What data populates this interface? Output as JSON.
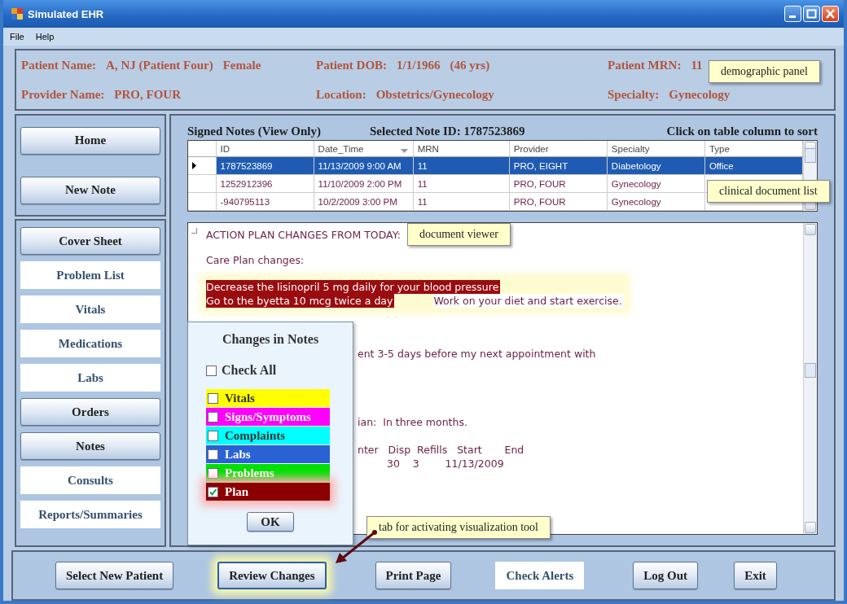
{
  "window": {
    "title": "Simulated EHR"
  },
  "menu": [
    "File",
    "Help"
  ],
  "demographics": [
    {
      "label": "Patient Name:",
      "values": [
        "A, NJ (Patient Four)",
        "Female"
      ]
    },
    {
      "label": "Patient DOB:",
      "values": [
        "1/1/1966",
        "(46 yrs)"
      ]
    },
    {
      "label": "Patient MRN:",
      "values": [
        "11"
      ]
    },
    {
      "label": "Provider Name:",
      "values": [
        "PRO, FOUR"
      ]
    },
    {
      "label": "Location:",
      "values": [
        "Obstetrics/Gynecology"
      ]
    },
    {
      "label": "Specialty:",
      "values": [
        "Gynecology"
      ]
    }
  ],
  "sidebar": {
    "top": [
      "Home",
      "New Note"
    ],
    "items": [
      {
        "label": "Cover Sheet",
        "kind": "raised"
      },
      {
        "label": "Problem List",
        "kind": "flat"
      },
      {
        "label": "Vitals",
        "kind": "flat"
      },
      {
        "label": "Medications",
        "kind": "flat"
      },
      {
        "label": "Labs",
        "kind": "flat"
      },
      {
        "label": "Orders",
        "kind": "raised"
      },
      {
        "label": "Notes",
        "kind": "raised"
      },
      {
        "label": "Consults",
        "kind": "flat"
      },
      {
        "label": "Reports/Summaries",
        "kind": "flat"
      }
    ]
  },
  "notes": {
    "title": "Signed Notes (View Only)",
    "selected_note": "Selected Note ID: 1787523869",
    "hint": "Click on table column to sort",
    "columns": [
      {
        "label": "ID",
        "sorted": false
      },
      {
        "label": "Date_Time",
        "sorted": true
      },
      {
        "label": "MRN",
        "sorted": false
      },
      {
        "label": "Provider",
        "sorted": false
      },
      {
        "label": "Specialty",
        "sorted": false
      },
      {
        "label": "Type",
        "sorted": false
      }
    ],
    "rows": [
      {
        "selected": true,
        "cells": [
          "1787523869",
          "11/13/2009 9:00 AM",
          "11",
          "PRO, EIGHT",
          "Diabetology",
          "Office"
        ]
      },
      {
        "selected": false,
        "cells": [
          "1252912396",
          "11/10/2009 2:00 PM",
          "11",
          "PRO, FOUR",
          "Gynecology"
        ]
      },
      {
        "selected": false,
        "cells": [
          "-940795113",
          "10/2/2009 3:00 PM",
          "11",
          "PRO, FOUR",
          "Gynecology"
        ]
      }
    ]
  },
  "viewer": {
    "paragraphs": [
      [
        {
          "kind": "plain",
          "segments": [
            {
              "text": "ACTION PLAN CHANGES FROM TODAY:",
              "highlight": false
            }
          ]
        }
      ],
      [
        {
          "kind": "plain",
          "segments": [
            {
              "text": "Care Plan changes:",
              "highlight": false
            }
          ]
        }
      ],
      [
        {
          "kind": "plain",
          "segments": [
            {
              "text": "Decrease the lisinopril 5 mg daily for your blood pressure",
              "highlight": true
            }
          ]
        },
        {
          "kind": "plain",
          "segments": [
            {
              "text": "Go to the byetta 10 mcg twice a day",
              "highlight": true
            },
            {
              "text": "Work on your diet and start exercise.",
              "highlight": false
            }
          ]
        }
      ],
      [
        {
          "kind": "partial",
          "segments": [
            {
              "text": "ent 3-5 days before my next appointment with",
              "highlight": false
            }
          ]
        }
      ],
      [
        {
          "kind": "partial",
          "segments": [
            {
              "text": "ian:  In three months.",
              "highlight": false
            }
          ]
        }
      ],
      [
        {
          "kind": "partial",
          "segments": [
            {
              "text": "nter   Disp  Refills   Start       End",
              "highlight": false
            }
          ]
        },
        {
          "kind": "partial-row",
          "segments": [
            {
              "text": "30    3        11/13/2009",
              "highlight": false
            }
          ]
        }
      ]
    ]
  },
  "changes_popup": {
    "title": "Changes in Notes",
    "check_all": {
      "label": "Check All",
      "checked": false
    },
    "items": [
      {
        "label": "Vitals",
        "color": "#ffff00",
        "checked": false
      },
      {
        "label": "Signs/Symptoms",
        "color": "#ff00ff",
        "checked": false
      },
      {
        "label": "Complaints",
        "color": "#00ffff",
        "checked": false
      },
      {
        "label": "Labs",
        "color": "#2a62d6",
        "checked": false
      },
      {
        "label": "Problems",
        "color": "#00e000",
        "checked": false
      },
      {
        "label": "Plan",
        "color": "#8b0000",
        "checked": true
      }
    ],
    "ok": "OK"
  },
  "footer": [
    {
      "label": "Select New Patient",
      "kind": "raised",
      "highlighted": false
    },
    {
      "label": "Review Changes",
      "kind": "raised",
      "highlighted": true
    },
    {
      "label": "Print Page",
      "kind": "raised",
      "highlighted": false
    },
    {
      "label": "Check Alerts",
      "kind": "flat",
      "highlighted": false
    },
    {
      "label": "Log Out",
      "kind": "raised",
      "highlighted": false
    },
    {
      "label": "Exit",
      "kind": "raised",
      "highlighted": false
    }
  ],
  "callouts": [
    {
      "text": "demographic panel",
      "pointer": false
    },
    {
      "text": "clinical document list",
      "pointer": false
    },
    {
      "text": "document viewer",
      "pointer": false
    },
    {
      "text": "tab for activating visualization tool",
      "pointer": true
    }
  ]
}
